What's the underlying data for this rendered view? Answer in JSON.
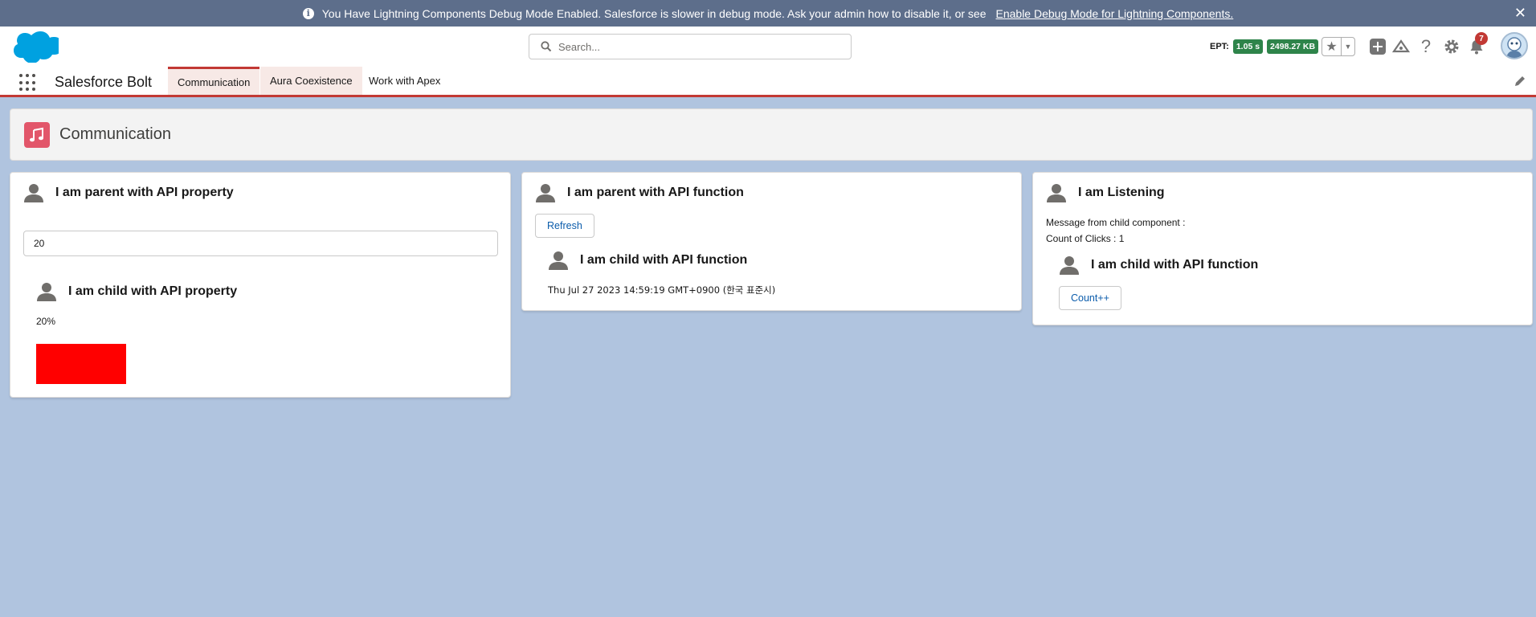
{
  "banner": {
    "message": "You Have Lightning Components Debug Mode Enabled. Salesforce is slower in debug mode. Ask your admin how to disable it, or see",
    "link_text": "Enable Debug Mode for Lightning Components.",
    "close_icon": "close-icon"
  },
  "header": {
    "search_placeholder": "Search...",
    "ept_label": "EPT:",
    "ept_time": "1.05 s",
    "ept_size": "2498.27 KB",
    "notification_count": "7"
  },
  "nav": {
    "app_name": "Salesforce Bolt",
    "tabs": [
      {
        "label": "Communication"
      },
      {
        "label": "Aura Coexistence"
      },
      {
        "label": "Work with Apex"
      }
    ]
  },
  "page": {
    "title": "Communication"
  },
  "card1": {
    "title": "I am parent with API property",
    "input_value": "20",
    "child_title": "I am child with API property",
    "percent_text": "20%"
  },
  "card2": {
    "title": "I am parent with API function",
    "refresh_label": "Refresh",
    "child_title": "I am child with API function",
    "timestamp": "Thu Jul 27 2023 14:59:19 GMT+0900 (한국 표준시)"
  },
  "card3": {
    "title": "I am Listening",
    "message_line": "Message from child component :",
    "count_line": "Count of Clicks : 1",
    "child_title": "I am child with API function",
    "count_button_label": "Count++"
  },
  "colors": {
    "banner_bg": "#5d6e8b",
    "page_bg": "#b0c4df",
    "brand_blue": "#00a1e0",
    "active_tab_border": "#c23934",
    "page_icon_bg": "#e2566a",
    "ept_badge": "#2e844a",
    "progress_box": "#ff0000"
  }
}
